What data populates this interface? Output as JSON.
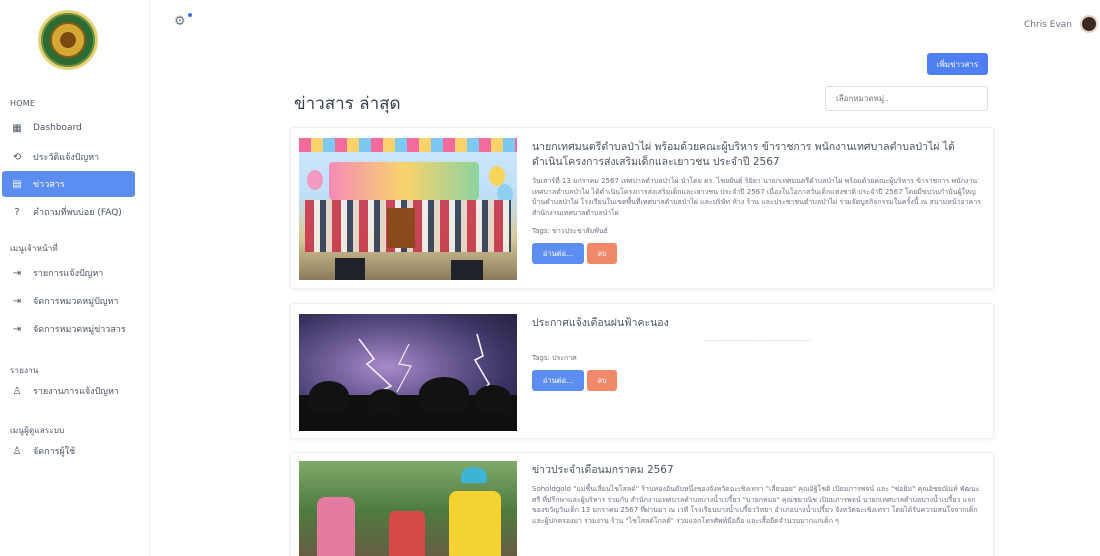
{
  "sidebar": {
    "sections": [
      {
        "title": "HOME"
      },
      {
        "title": "เมนูเจ้าหน้าที่"
      },
      {
        "title": "รายงาน"
      },
      {
        "title": "เมนูผู้ดูแลระบบ"
      }
    ],
    "items": [
      {
        "label": "Dashboard",
        "icon": "grid-icon",
        "active": false
      },
      {
        "label": "ประวัติแจ้งปัญหา",
        "icon": "history-icon",
        "active": false
      },
      {
        "label": "ข่าวสาร",
        "icon": "news-icon",
        "active": true
      },
      {
        "label": "คำถามที่พบบ่อย (FAQ)",
        "icon": "question-icon",
        "active": false
      },
      {
        "label": "รายการแจ้งปัญหา",
        "icon": "login-icon",
        "active": false
      },
      {
        "label": "จัดการหมวดหมู่ปัญหา",
        "icon": "login-icon",
        "active": false
      },
      {
        "label": "จัดการหมวดหมู่ข่าวสาร",
        "icon": "login-icon",
        "active": false
      },
      {
        "label": "รายงานการแจ้งปัญหา",
        "icon": "user-icon",
        "active": false
      },
      {
        "label": "จัดการผู้ใช้",
        "icon": "user-icon",
        "active": false
      }
    ],
    "active_color": "#5b8ef0"
  },
  "topbar": {
    "user_name": "Chris Evan"
  },
  "main": {
    "title": "ข่าวสาร ล่าสุด",
    "add_button": "เพิ่มข่าวสาร",
    "search_placeholder": "เลือกหมวดหมู่..",
    "read_more_label": "อ่านต่อ...",
    "delete_label": "ลบ",
    "posts": [
      {
        "title": "นายกเทศมนตรีตำบลป่าไผ่ พร้อมด้วยคณะผู้บริหาร ข้าราชการ พนักงานเทศบาลตำบลป่าไผ่ ได้ดำเนินโครงการส่งเสริมเด็กและเยาวชน ประจำปี 2567",
        "description": "วันเสาร์ที่ 13 มกราคม 2567 เทศบาลตำบลป่าไผ่ นำโดย ดร. ไชยยันต์ ริยิยา นายกเทศมนตรีตำบลป่าไผ่ พร้อมด้วยคณะผู้บริหาร ข้าราชการ พนักงานเทศบาลตำบลป่าไผ่ ได้ดำเนินโครงการส่งเสริมเด็กและเยาวชน ประจำปี 2567 เนื่องในโอกาสวันเด็กแห่งชาติ ประจำปี 2567 โดยมีขบวนกำนันผู้ใหญ่บ้านตำบลป่าไผ่ โรงเรียนในเขตพื้นที่เทศบาลตำบลป่าไผ่ และบริษัท ห้าง ร้าน และประชาชนตำบลป่าไผ่ ร่วมจัดบูธกิจกรรมในครั้งนี้ ณ สนามหน้าอาคารสำนักงานเทศบาลตำบลป่าไผ่",
        "separator": "",
        "tags": "Tags: ข่าวประชาสัมพันธ์"
      },
      {
        "title": "ประกาศแจ้งเตือนฝนฟ้าคะนอง",
        "description": "",
        "separator": "------------------------------------------",
        "tags": "Tags: ประกาศ"
      },
      {
        "title": "ข่าวประจำเดือนมกราคม 2567",
        "description": "Soholdgold \"แม่ชื้นเลี่ยนไชโสลด์\" ร้านทองอันดับหนึ่งของจังหวัดฉะเชิงเทรา \"เลี่ยนอย\" คุณอิฐิโชติ เปิยมภารพจน์ และ \"ช่อยิม\" คุณอิชยณินท์ พัฒนะศรี ที่ปรึกษาและผู้บริหาร ร่วมกับ สำนักงานเทศบาลตำบลบางน้ำเปรี้ยว \"นายกหมอ\" คุณชยาณิช เปิยมภารพจน์ นายกเทศบาลตำบลบางน้ำเปรี้ยว แจกของขวัญวันเด็ก 13 มกราคม 2567 ที่ผ่านมา ณ เวที โรงเรียนบางน้ำเปรี้ยววิทยา อำเภอบางน้ำเปรี้ยว จังหวัดฉะเชิงเทรา โดยได้รับความสนใจจากเด็ก และผู้ปกครองมา ร่วมงาน ร้าน \"ไชโสลด์โกลด์\" ร่วมแจกโทรศัพท์มือถือ และเสื้อยืดจำนวนมากแก่เด็ก ๆ",
        "separator": "",
        "tags": ""
      }
    ]
  }
}
